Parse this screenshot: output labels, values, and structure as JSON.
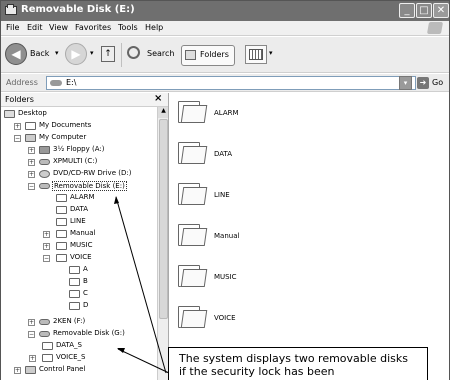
{
  "window": {
    "title": "Removable Disk (E:)"
  },
  "menu": [
    "File",
    "Edit",
    "View",
    "Favorites",
    "Tools",
    "Help"
  ],
  "toolbar": {
    "back_label": "Back",
    "search_label": "Search",
    "folders_label": "Folders"
  },
  "address": {
    "label": "Address",
    "value": "E:\\",
    "go_label": "Go"
  },
  "folders_pane": {
    "title": "Folders",
    "tree": {
      "desktop": "Desktop",
      "my_documents": "My Documents",
      "my_computer": "My Computer",
      "floppy": "3½ Floppy (A:)",
      "xpmulti": "XPMULTI (C:)",
      "dvd": "DVD/CD-RW Drive (D:)",
      "removable_e": "Removable Disk (E:)",
      "alarm": "ALARM",
      "data": "DATA",
      "line": "LINE",
      "manual": "Manual",
      "music": "MUSIC",
      "voice": "VOICE",
      "a": "A",
      "b": "B",
      "c": "C",
      "d": "D",
      "zken": "2KEN (F:)",
      "removable_g": "Removable Disk (G:)",
      "data_s": "DATA_S",
      "voice_s": "VOICE_S",
      "control_panel": "Control Panel"
    }
  },
  "content": {
    "items": [
      "ALARM",
      "DATA",
      "LINE",
      "Manual",
      "MUSIC",
      "VOICE"
    ]
  },
  "callout": {
    "text": "The system displays two removable disks if the security lock has been"
  }
}
